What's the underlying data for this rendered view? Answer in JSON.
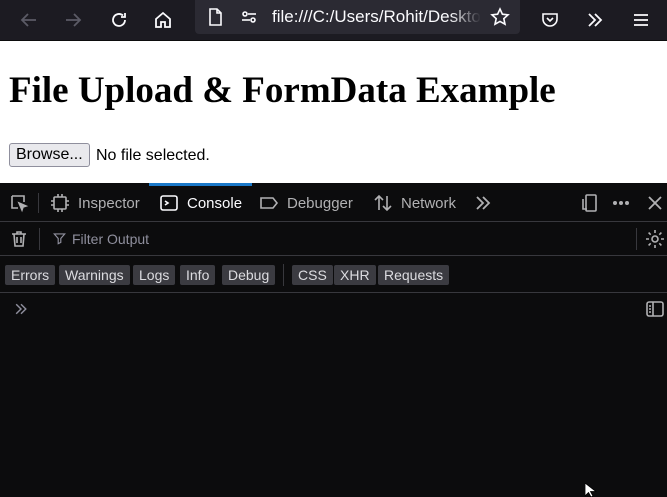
{
  "browser": {
    "url": "file:///C:/Users/Rohit/Desktop/"
  },
  "page": {
    "heading": "File Upload & FormData Example",
    "browse_label": "Browse...",
    "file_status": "No file selected."
  },
  "devtools": {
    "tabs": [
      {
        "label": "Inspector"
      },
      {
        "label": "Console"
      },
      {
        "label": "Debugger"
      },
      {
        "label": "Network"
      }
    ],
    "filter_placeholder": "Filter Output",
    "level_filters": [
      "Errors",
      "Warnings",
      "Logs",
      "Info",
      "Debug"
    ],
    "type_filters": [
      "CSS",
      "XHR",
      "Requests"
    ]
  },
  "theme": {
    "accent": "#1a78c8",
    "toolbar_bg": "#1c1b22",
    "devtools_bg": "#0c0c0d"
  }
}
